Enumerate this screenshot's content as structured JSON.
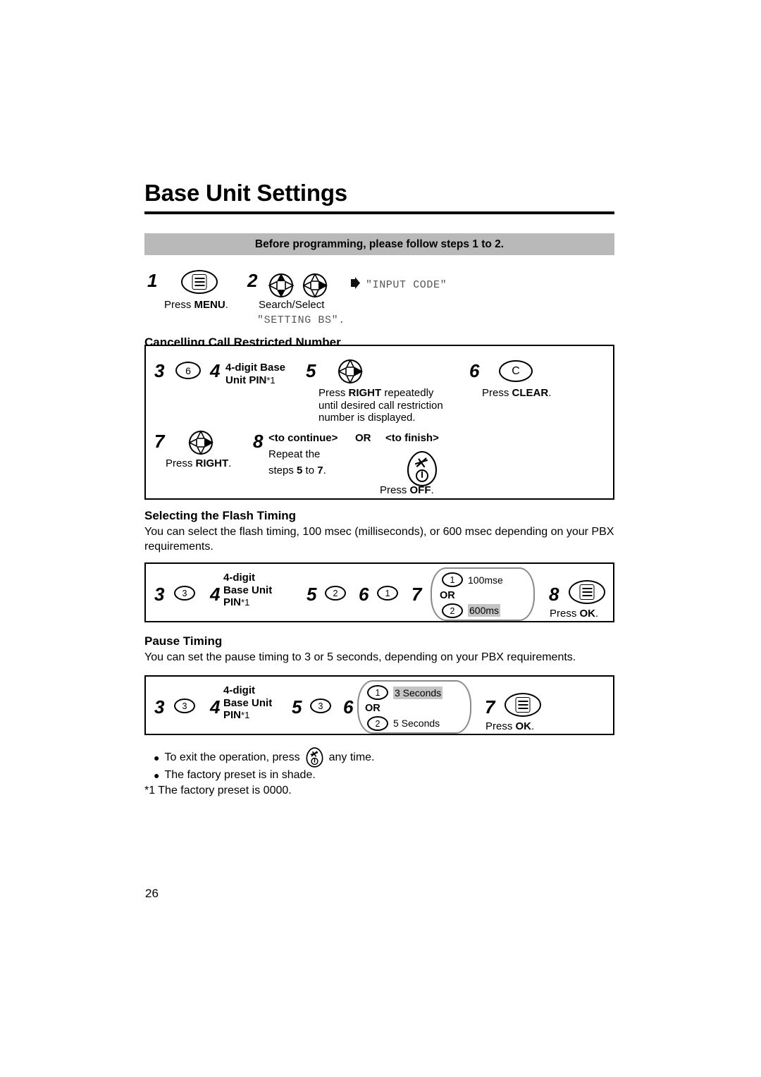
{
  "page": {
    "title": "Base Unit Settings",
    "number": "26",
    "banner": "Before programming, please follow steps 1 to 2."
  },
  "intro": {
    "step1_num": "1",
    "step1_caption_pre": "Press ",
    "step1_caption_bold": "MENU",
    "step1_caption_post": ".",
    "step1_icon": "menu-icon",
    "step2_num": "2",
    "step2_icon_a": "navigation-updown-icon",
    "step2_icon_b": "navigation-right-icon",
    "step2_caption_line1": "Search/Select",
    "step2_caption_line2": "\"SETTING BS\".",
    "display_marker": "filled-right-arrow",
    "display_text": "\"INPUT CODE\""
  },
  "cancel_section": {
    "heading": "Cancelling Call Restricted Number",
    "step3_num": "3",
    "step3_key": "6",
    "step4_num": "4",
    "step4_line1": "4-digit Base",
    "step4_line2": "Unit PIN",
    "step4_footnote": "*1",
    "step5_num": "5",
    "step5_icon": "navigation-right-icon",
    "step5_line1": "Press RIGHT repeatedly",
    "step5_line1_pre": "Press ",
    "step5_line1_bold": "RIGHT",
    "step5_line1_post": " repeatedly",
    "step5_line2": "until desired call restriction",
    "step5_line3": "number is displayed.",
    "step6_num": "6",
    "step6_key": "C",
    "step6_caption_pre": "Press ",
    "step6_caption_bold": "CLEAR",
    "step6_caption_post": ".",
    "step7_num": "7",
    "step7_icon": "navigation-right-icon",
    "step7_caption_pre": "Press ",
    "step7_caption_bold": "RIGHT",
    "step7_caption_post": ".",
    "step8_num": "8",
    "step8_continue": "<to continue>",
    "step8_or": "OR",
    "step8_finish": "<to finish>",
    "step8_repeat_line1": "Repeat the",
    "step8_repeat_line2_pre": "steps ",
    "step8_repeat_line2_b1": "5",
    "step8_repeat_line2_mid": " to ",
    "step8_repeat_line2_b2": "7",
    "step8_repeat_line2_post": ".",
    "step8_off_icon": "power-off-icon",
    "step8_off_pre": "Press ",
    "step8_off_bold": "OFF",
    "step8_off_post": "."
  },
  "flash_section": {
    "heading": "Selecting the Flash Timing",
    "body": "You can select the flash timing, 100 msec (milliseconds), or 600 msec depending on your PBX requirements.",
    "step3_num": "3",
    "step3_key": "3",
    "step4_num": "4",
    "step4_line1": "4-digit",
    "step4_line2": "Base Unit",
    "step4_line3": "PIN",
    "step4_footnote": "*1",
    "step5_num": "5",
    "step5_key": "2",
    "step6_num": "6",
    "step6_key": "1",
    "step7_num": "7",
    "option1_key": "1",
    "option1_label": "100mse",
    "option_or": "OR",
    "option2_key": "2",
    "option2_label": "600ms",
    "option2_shaded": true,
    "step8_num": "8",
    "step8_icon": "menu-icon",
    "step8_caption_pre": "Press ",
    "step8_caption_bold": "OK",
    "step8_caption_post": "."
  },
  "pause_section": {
    "heading": "Pause Timing",
    "body": "You can set the pause timing to 3 or 5 seconds, depending on your PBX requirements.",
    "step3_num": "3",
    "step3_key": "3",
    "step4_num": "4",
    "step4_line1": "4-digit",
    "step4_line2": "Base Unit",
    "step4_line3": "PIN",
    "step4_footnote": "*1",
    "step5_num": "5",
    "step5_key": "3",
    "step6_num": "6",
    "option1_key": "1",
    "option1_label": "3 Seconds",
    "option_or": "OR",
    "option2_key": "2",
    "option2_label": "5 Seconds",
    "option1_shaded": true,
    "step7_num": "7",
    "step7_icon": "menu-icon",
    "step7_caption_pre": "Press ",
    "step7_caption_bold": "OK",
    "step7_caption_post": "."
  },
  "notes": {
    "note1_pre": "To exit the operation, press",
    "note1_icon": "power-off-icon",
    "note1_post": "any time.",
    "note2": "The factory preset is in shade.",
    "note3": "*1 The factory preset is 0000."
  },
  "colors": {
    "banner_bg": "#b9b9b9",
    "shade_bg": "#c4c4c4",
    "ink": "#000000",
    "bracket": "#8a8a8a",
    "lcd_text": "#555555"
  }
}
